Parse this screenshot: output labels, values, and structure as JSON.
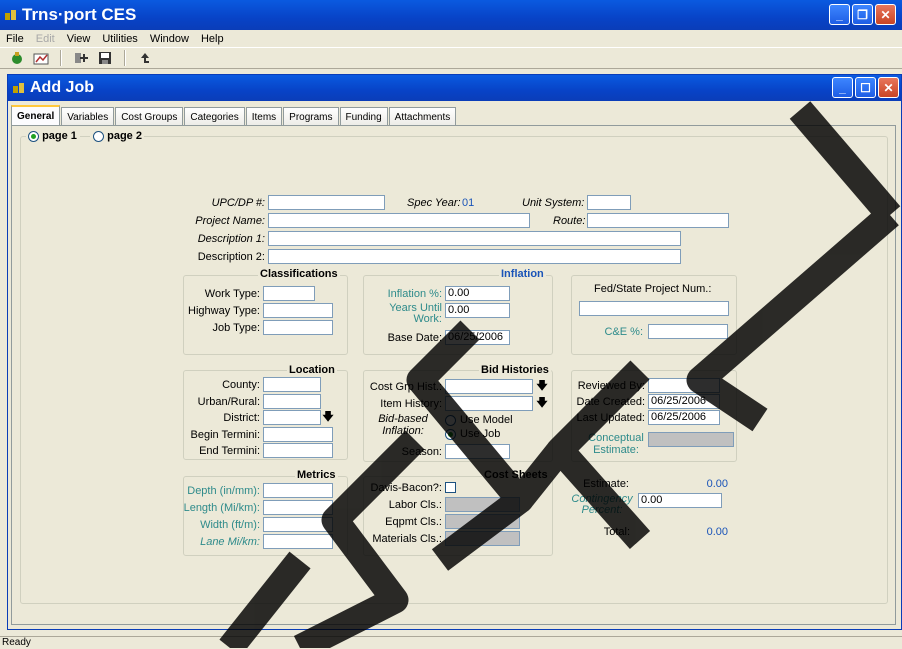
{
  "app": {
    "title": "Trns·port CES",
    "menu": [
      "File",
      "Edit",
      "View",
      "Utilities",
      "Window",
      "Help"
    ],
    "toolbar": [
      "open-icon",
      "report-icon",
      "add-icon",
      "save-icon",
      "up-icon"
    ]
  },
  "child_window": {
    "title": "Add Job",
    "tabs": [
      "General",
      "Variables",
      "Cost Groups",
      "Categories",
      "Items",
      "Programs",
      "Funding",
      "Attachments"
    ],
    "active_tab": "General",
    "pages": [
      "page 1",
      "page 2"
    ]
  },
  "header_fields": {
    "upc_label": "UPC/DP #:",
    "upc_value": "",
    "spec_year_label": "Spec Year:",
    "spec_year_value": "01",
    "unit_system_label": "Unit System:",
    "unit_system_value": "",
    "project_name_label": "Project Name:",
    "project_name_value": "",
    "route_label": "Route:",
    "route_value": "",
    "desc1_label": "Description 1:",
    "desc1_value": "",
    "desc2_label": "Description 2:",
    "desc2_value": ""
  },
  "classifications": {
    "title": "Classifications",
    "work_type_label": "Work Type:",
    "highway_type_label": "Highway Type:",
    "job_type_label": "Job Type:"
  },
  "inflation": {
    "title": "Inflation",
    "inflation_pct_label": "Inflation %:",
    "inflation_pct_value": "0.00",
    "years_until_label": "Years Until Work:",
    "years_until_value": "0.00",
    "base_date_label": "Base Date:",
    "base_date_value": "06/25/2006"
  },
  "fed_state": {
    "project_num_label": "Fed/State Project Num.:",
    "ce_pct_label": "C&E %:"
  },
  "location": {
    "title": "Location",
    "county_label": "County:",
    "urban_rural_label": "Urban/Rural:",
    "district_label": "District:",
    "begin_termini_label": "Begin Termini:",
    "end_termini_label": "End Termini:"
  },
  "bid_histories": {
    "title": "Bid Histories",
    "cost_grp_label": "Cost Grp Hist.:",
    "item_history_label": "Item History:",
    "bid_based_label": "Bid-based Inflation:",
    "use_model_label": "Use Model",
    "use_job_label": "Use Job",
    "season_label": "Season:"
  },
  "review": {
    "reviewed_by_label": "Reviewed By:",
    "date_created_label": "Date Created:",
    "date_created_value": "06/25/2006",
    "last_updated_label": "Last Updated:",
    "last_updated_value": "06/25/2006",
    "conceptual_label": "Conceptual Estimate:"
  },
  "metrics": {
    "title": "Metrics",
    "depth_label": "Depth (in/mm):",
    "length_label": "Length (Mi/km):",
    "width_label": "Width (ft/m):",
    "lane_label": "Lane Mi/km:"
  },
  "cost_sheets": {
    "title": "Cost Sheets",
    "davis_bacon_label": "Davis-Bacon?:",
    "labor_label": "Labor Cls.:",
    "eqpmt_label": "Eqpmt Cls.:",
    "materials_label": "Materials Cls.:"
  },
  "estimate": {
    "estimate_label": "Estimate:",
    "estimate_value": "0.00",
    "contingency_label": "Contingency Percent:",
    "contingency_value": "0.00",
    "total_label": "Total:",
    "total_value": "0.00"
  },
  "status_bar": "Ready",
  "colors": {
    "titlebar": "#0843C7",
    "accent_blue": "#1a54b8",
    "teal": "#2E8B8B",
    "window_bg": "#ECE9D8"
  }
}
